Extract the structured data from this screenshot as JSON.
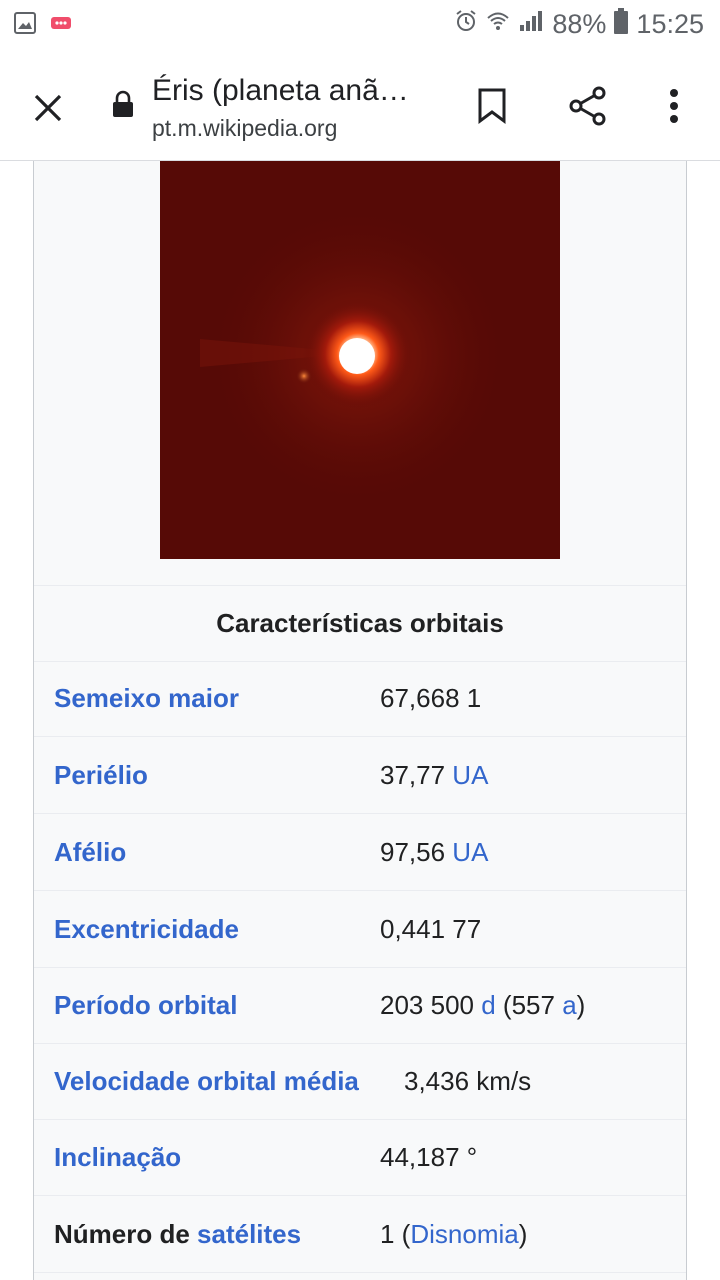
{
  "status_bar": {
    "battery": "88%",
    "time": "15:25",
    "icons": [
      "gallery-notification-icon",
      "app-notification-icon",
      "alarm-icon",
      "wifi-icon",
      "signal-icon",
      "battery-icon"
    ]
  },
  "toolbar": {
    "title": "Éris (planeta anã…",
    "url": "pt.m.wikipedia.org",
    "icons": [
      "close-icon",
      "lock-icon",
      "bookmark-icon",
      "share-icon",
      "more-vert-icon"
    ]
  },
  "infobox": {
    "image_alt_colors": {
      "background": "#5a0a06",
      "glow": "#ff3c10",
      "core": "#ffffff"
    },
    "section_title": "Características orbitais",
    "rows": [
      {
        "label": "Semeixo maior",
        "value": "67,668 1",
        "unit_link": "",
        "suffix": ""
      },
      {
        "label": "Periélio",
        "value": "37,77 ",
        "unit_link": "UA",
        "suffix": ""
      },
      {
        "label": "Afélio",
        "value": "97,56 ",
        "unit_link": "UA",
        "suffix": ""
      },
      {
        "label": "Excentricidade",
        "value": "0,441 77",
        "unit_link": "",
        "suffix": ""
      },
      {
        "label": "Período orbital",
        "value": "203 500 ",
        "unit_link": "d",
        "suffix_a": " (557 ",
        "unit_link_2": "a",
        "suffix": ")"
      },
      {
        "label": "Velocidade orbital média",
        "value": "3,436 km/s",
        "unit_link": "",
        "suffix": ""
      },
      {
        "label": "Inclinação",
        "value": "44,187 °",
        "unit_link": "",
        "suffix": ""
      },
      {
        "label_plain": "Número de ",
        "label_link": "satélites",
        "value": "1 (",
        "value_link": "Disnomia",
        "suffix": ")"
      }
    ]
  },
  "colors": {
    "link": "#3366cc",
    "text": "#202122",
    "infobox_bg": "#f8f9fa"
  }
}
